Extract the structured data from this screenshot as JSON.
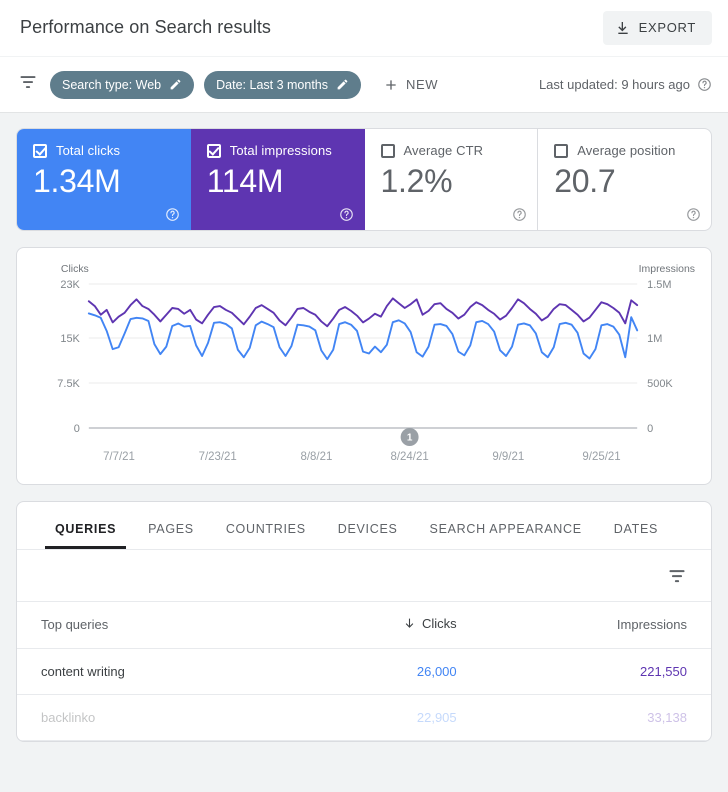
{
  "header": {
    "title": "Performance on Search results",
    "export_label": "EXPORT",
    "export_icon": "download-icon"
  },
  "filter_bar": {
    "funnel_icon": "filter-funnel-icon",
    "chips": [
      {
        "label": "Search type: Web",
        "edit_icon": "pencil-icon"
      },
      {
        "label": "Date: Last 3 months",
        "edit_icon": "pencil-icon"
      }
    ],
    "new_label": "NEW",
    "new_icon": "plus-icon",
    "last_updated": "Last updated: 9 hours ago",
    "help_icon": "help-circle-icon"
  },
  "metrics": [
    {
      "name": "Total clicks",
      "value": "1.34M",
      "checked": true,
      "color": "#4285f4",
      "help_icon": "help-circle-icon"
    },
    {
      "name": "Total impressions",
      "value": "114M",
      "checked": true,
      "color": "#5e35b1",
      "help_icon": "help-circle-icon"
    },
    {
      "name": "Average CTR",
      "value": "1.2%",
      "checked": false,
      "color": "#ffffff",
      "help_icon": "help-circle-icon"
    },
    {
      "name": "Average position",
      "value": "20.7",
      "checked": false,
      "color": "#ffffff",
      "help_icon": "help-circle-icon"
    }
  ],
  "chart_data": {
    "type": "line",
    "title": "",
    "left_axis_label": "Clicks",
    "right_axis_label": "Impressions",
    "left_ticks": [
      "23K",
      "15K",
      "7.5K",
      "0"
    ],
    "left_tick_values": [
      23000,
      15000,
      7500,
      0
    ],
    "right_ticks": [
      "1.5M",
      "1M",
      "500K",
      "0"
    ],
    "right_tick_values": [
      1500000,
      1000000,
      500000,
      0
    ],
    "ylim_clicks": [
      0,
      23000
    ],
    "ylim_impressions": [
      0,
      1500000
    ],
    "x_ticks": [
      "7/7/21",
      "7/23/21",
      "8/8/21",
      "8/24/21",
      "9/9/21",
      "9/25/21"
    ],
    "x_range": [
      "7/3/21",
      "10/1/21"
    ],
    "grid": true,
    "legend_position": "none",
    "annotations": [
      {
        "label": "1",
        "x_position": "8/24/21"
      }
    ],
    "series": [
      {
        "name": "Clicks",
        "color": "#4285f4",
        "axis": "left",
        "values": [
          18300,
          18000,
          17600,
          15500,
          12600,
          12900,
          15100,
          17400,
          17600,
          17500,
          17100,
          13400,
          11800,
          13000,
          16300,
          16700,
          16200,
          16300,
          13200,
          11500,
          13600,
          16800,
          16900,
          16600,
          15900,
          12500,
          11300,
          12800,
          16400,
          17000,
          16600,
          16100,
          12900,
          11500,
          13100,
          16500,
          16400,
          16200,
          15600,
          12400,
          11000,
          12500,
          16600,
          16900,
          16500,
          15500,
          12200,
          11900,
          13000,
          12100,
          13300,
          16900,
          17200,
          16700,
          15300,
          12100,
          11400,
          13000,
          16500,
          16600,
          16300,
          15000,
          12200,
          11600,
          13200,
          16900,
          17100,
          16600,
          15400,
          12400,
          11500,
          13000,
          16500,
          16700,
          16400,
          15100,
          12100,
          11300,
          12900,
          16600,
          16800,
          16500,
          15200,
          11900,
          11100,
          12600,
          16400,
          16600,
          16200,
          14900,
          11300,
          17700,
          15600
        ]
      },
      {
        "name": "Impressions",
        "color": "#5e35b1",
        "axis": "right",
        "values": [
          1320000,
          1270000,
          1180000,
          1230000,
          1100000,
          1160000,
          1200000,
          1280000,
          1340000,
          1270000,
          1240000,
          1180000,
          1110000,
          1180000,
          1250000,
          1240000,
          1190000,
          1230000,
          1130000,
          1090000,
          1180000,
          1260000,
          1270000,
          1230000,
          1200000,
          1140000,
          1080000,
          1160000,
          1250000,
          1280000,
          1240000,
          1200000,
          1120000,
          1070000,
          1150000,
          1240000,
          1250000,
          1210000,
          1180000,
          1110000,
          1060000,
          1140000,
          1230000,
          1260000,
          1220000,
          1170000,
          1100000,
          1140000,
          1190000,
          1160000,
          1270000,
          1350000,
          1300000,
          1250000,
          1290000,
          1340000,
          1180000,
          1220000,
          1290000,
          1300000,
          1240000,
          1200000,
          1140000,
          1180000,
          1260000,
          1310000,
          1280000,
          1230000,
          1190000,
          1130000,
          1170000,
          1250000,
          1340000,
          1300000,
          1240000,
          1190000,
          1120000,
          1160000,
          1240000,
          1290000,
          1280000,
          1230000,
          1180000,
          1110000,
          1150000,
          1230000,
          1310000,
          1290000,
          1250000,
          1200000,
          1090000,
          1330000,
          1280000
        ]
      }
    ]
  },
  "table_card": {
    "tabs": [
      {
        "label": "QUERIES",
        "active": true
      },
      {
        "label": "PAGES",
        "active": false
      },
      {
        "label": "COUNTRIES",
        "active": false
      },
      {
        "label": "DEVICES",
        "active": false
      },
      {
        "label": "SEARCH APPEARANCE",
        "active": false
      },
      {
        "label": "DATES",
        "active": false
      }
    ],
    "filter_icon": "filter-funnel-icon",
    "columns": {
      "query": "Top queries",
      "clicks": "Clicks",
      "impressions": "Impressions",
      "sort_icon": "sort-descending-arrow-icon"
    },
    "rows": [
      {
        "query": "content writing",
        "clicks": "26,000",
        "impressions": "221,550",
        "faded": false
      },
      {
        "query": "backlinko",
        "clicks": "22,905",
        "impressions": "33,138",
        "faded": true
      }
    ]
  }
}
